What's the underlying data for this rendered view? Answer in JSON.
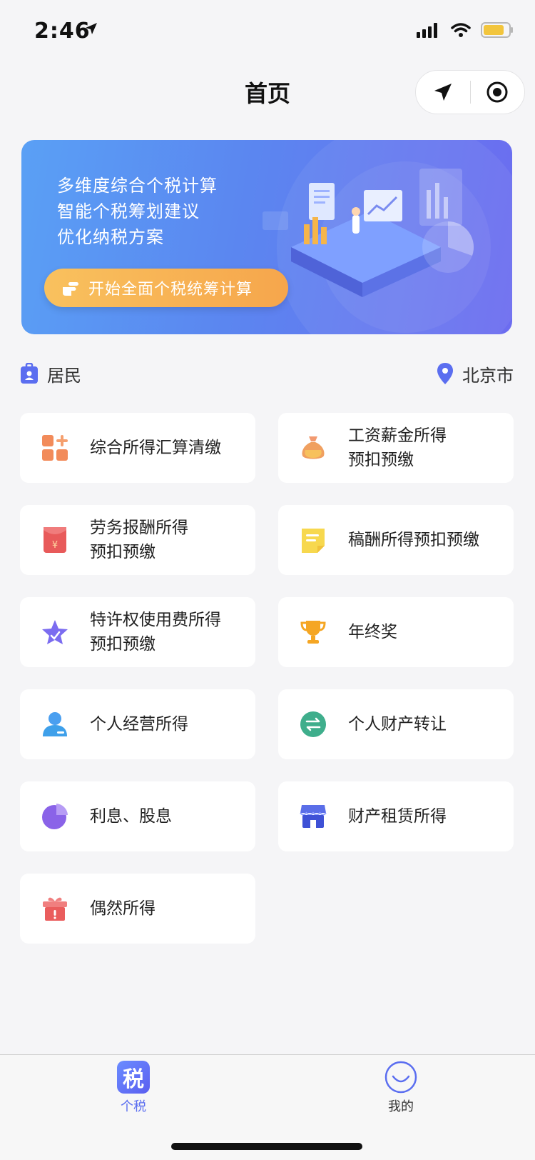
{
  "status_bar": {
    "time": "2:46"
  },
  "nav": {
    "title": "首页"
  },
  "banner": {
    "lines": [
      "多维度综合个税计算",
      "智能个税筹划建议",
      "优化纳税方案"
    ],
    "cta_label": "开始全面个税统筹计算"
  },
  "identity": {
    "resident_label": "居民",
    "city_label": "北京市"
  },
  "items": [
    {
      "label": "综合所得汇算清缴",
      "icon": "grid-plus-icon"
    },
    {
      "label": "工资薪金所得\n预扣预缴",
      "icon": "money-bag-icon"
    },
    {
      "label": "劳务报酬所得\n预扣预缴",
      "icon": "red-envelope-icon"
    },
    {
      "label": "稿酬所得预扣预缴",
      "icon": "document-icon"
    },
    {
      "label": "特许权使用费所得\n预扣预缴",
      "icon": "star-icon"
    },
    {
      "label": "年终奖",
      "icon": "trophy-icon"
    },
    {
      "label": "个人经营所得",
      "icon": "person-icon"
    },
    {
      "label": "个人财产转让",
      "icon": "transfer-icon"
    },
    {
      "label": "利息、股息",
      "icon": "pie-chart-icon"
    },
    {
      "label": "财产租赁所得",
      "icon": "storefront-icon"
    },
    {
      "label": "偶然所得",
      "icon": "gift-icon"
    }
  ],
  "tabs": [
    {
      "label": "个税",
      "icon_glyph": "税"
    },
    {
      "label": "我的"
    }
  ],
  "colors": {
    "accent": "#5b6ef0",
    "banner_start": "#5aa0f5",
    "banner_end": "#6c6cf0",
    "cta": "#f6a64c"
  }
}
